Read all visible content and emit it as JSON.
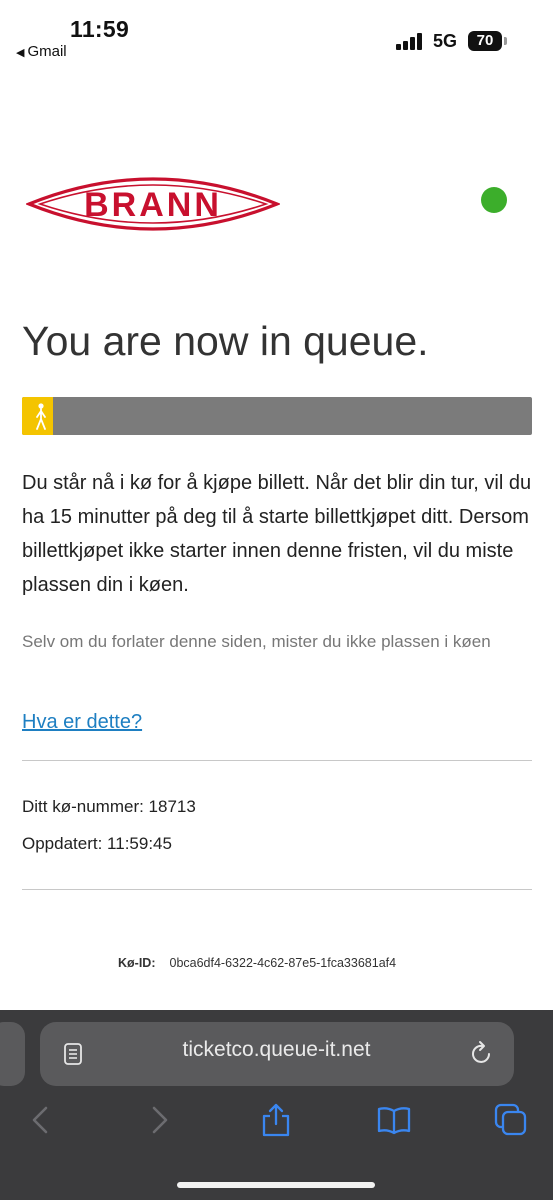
{
  "status_bar": {
    "time": "11:59",
    "back_app": "Gmail",
    "network": "5G",
    "battery": "70"
  },
  "header": {
    "logo_text": "BRANN",
    "status_dot_color": "#3cae2b",
    "brand_color": "#c8102e"
  },
  "queue": {
    "title": "You are now in queue.",
    "progress_fraction": 0.06,
    "message": "Du står nå i kø for å kjøpe billett. Når det blir din tur, vil du ha 15 minutter på deg til å starte billettkjøpet ditt. Dersom billettkjøpet ikke starter innen denne fristen, vil du miste plassen din i køen.",
    "note": "Selv om du forlater denne siden, mister du ikke plassen i køen",
    "help_link": "Hva er dette?",
    "queue_number_line": "Ditt kø-nummer: 18713",
    "updated_line": "Oppdatert: 11:59:45",
    "queue_id_label": "Kø-ID:",
    "queue_id_value": "0bca6df4-6322-4c62-87e5-1fca33681af4"
  },
  "browser": {
    "url": "ticketco.queue-it.net",
    "icons": [
      "reader-icon",
      "reload-icon",
      "back-icon",
      "forward-icon",
      "share-icon",
      "bookmarks-icon",
      "tabs-icon"
    ]
  }
}
